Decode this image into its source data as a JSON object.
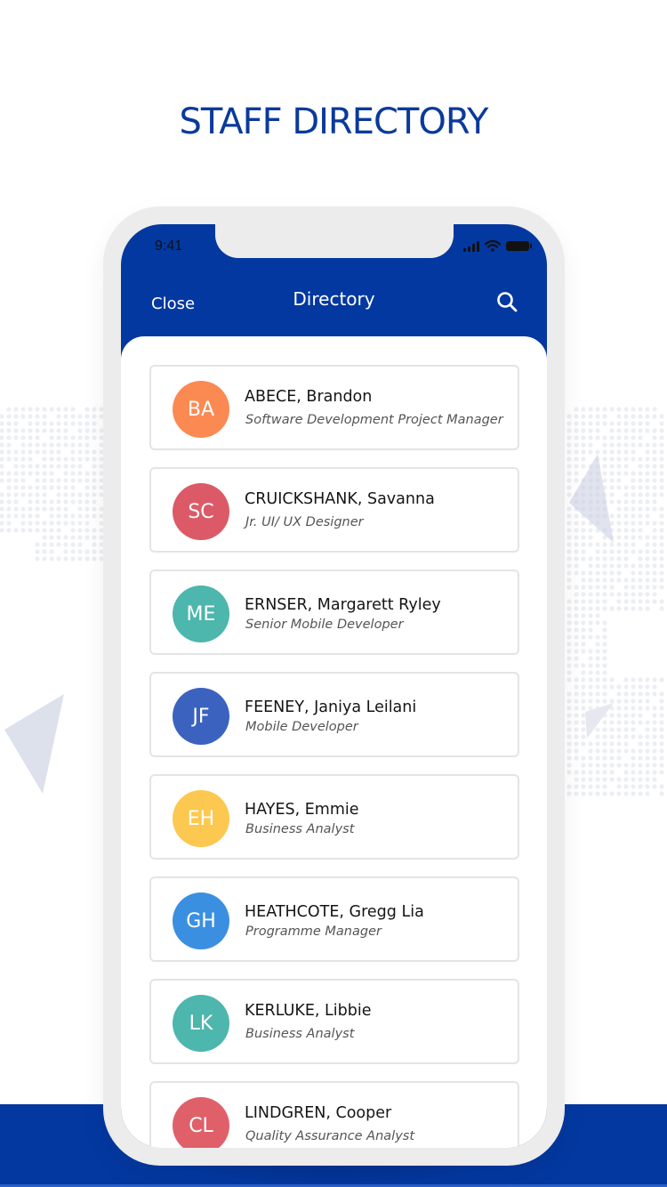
{
  "page_title": "STAFF DIRECTORY",
  "colors": {
    "brand_blue": "#0338a0",
    "title_blue": "#0a3a9a",
    "phone_frame": "#ececec"
  },
  "status_bar": {
    "time": "9:41",
    "icons": [
      "cellular-signal-icon",
      "wifi-icon",
      "battery-icon"
    ]
  },
  "nav": {
    "close_label": "Close",
    "title": "Directory",
    "search_icon": "search-icon"
  },
  "staff": [
    {
      "initials": "BA",
      "name": "ABECE, Brandon",
      "role": "Software Development Project Manager",
      "color": "#fa8a52",
      "layout": "spread"
    },
    {
      "initials": "SC",
      "name": "CRUICKSHANK, Savanna",
      "role": "Jr. UI/ UX Designer",
      "color": "#dc5a67",
      "layout": "spread"
    },
    {
      "initials": "ME",
      "name": "ERNSER,  Margarett Ryley",
      "role": "Senior Mobile Developer",
      "color": "#4db6ad",
      "layout": "tight"
    },
    {
      "initials": "JF",
      "name": "FEENEY, Janiya Leilani",
      "role": "Mobile Developer",
      "color": "#3c62bf",
      "layout": "tight"
    },
    {
      "initials": "EH",
      "name": "HAYES,  Emmie",
      "role": "Business Analyst",
      "color": "#fcc84f",
      "layout": "tight"
    },
    {
      "initials": "GH",
      "name": "HEATHCOTE,  Gregg Lia",
      "role": "Programme Manager",
      "color": "#3b8fe0",
      "layout": "tight"
    },
    {
      "initials": "LK",
      "name": "KERLUKE, Libbie",
      "role": "Business Analyst",
      "color": "#4db6ad",
      "layout": "spread"
    },
    {
      "initials": "CL",
      "name": "LINDGREN, Cooper",
      "role": "Quality Assurance Analyst",
      "color": "#e0606a",
      "layout": "spread"
    }
  ]
}
